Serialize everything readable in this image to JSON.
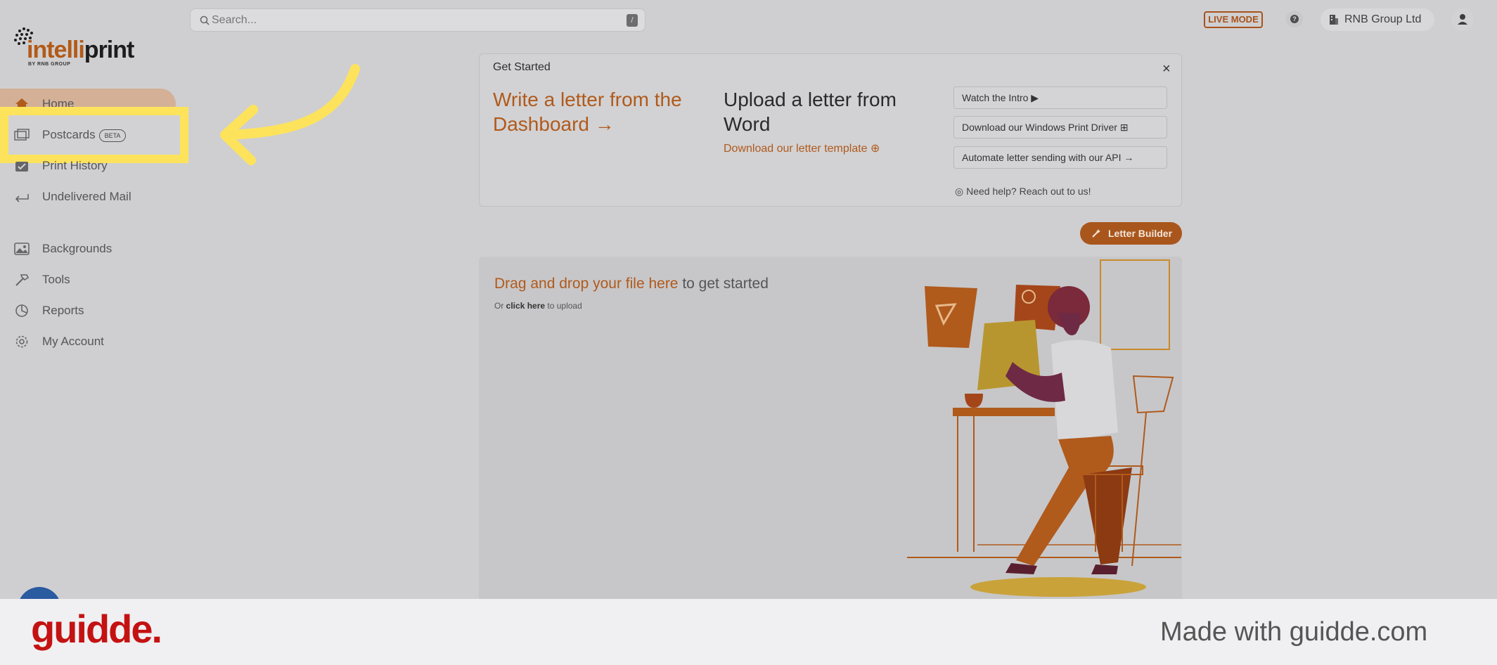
{
  "search": {
    "placeholder": "Search...",
    "shortcut": "/"
  },
  "header": {
    "live_mode": "LIVE MODE",
    "org_name": "RNB Group Ltd"
  },
  "logo": {
    "part1": "intelli",
    "part2": "print",
    "tagline": "BY RNB GROUP"
  },
  "sidebar": {
    "items": [
      {
        "label": "Home"
      },
      {
        "label": "Postcards",
        "badge": "BETA"
      },
      {
        "label": "Print History"
      },
      {
        "label": "Undelivered Mail"
      },
      {
        "label": "Backgrounds"
      },
      {
        "label": "Tools"
      },
      {
        "label": "Reports"
      },
      {
        "label": "My Account"
      }
    ]
  },
  "get_started": {
    "title": "Get Started",
    "close": "×",
    "write_letter": "Write a letter from the Dashboard →",
    "upload_letter": "Upload a letter from Word",
    "download_template": "Download our letter template ⊕",
    "buttons": [
      "Watch the Intro ▶",
      "Download our Windows Print Driver ⊞",
      "Automate letter sending with our API →"
    ],
    "need_help": "◎ Need help? Reach out to us!"
  },
  "letter_builder": "Letter Builder",
  "upload_panel": {
    "drag_highlight": "Drag and drop your file here",
    "drag_rest": " to get started",
    "or": "Or ",
    "click_here": "click here",
    "to_upload": " to upload"
  },
  "footer": {
    "brand": "guidde.",
    "made_with": "Made with guidde.com"
  },
  "colors": {
    "accent": "#b05a1c",
    "highlight": "#fde35b",
    "guidde_red": "#c41212"
  }
}
